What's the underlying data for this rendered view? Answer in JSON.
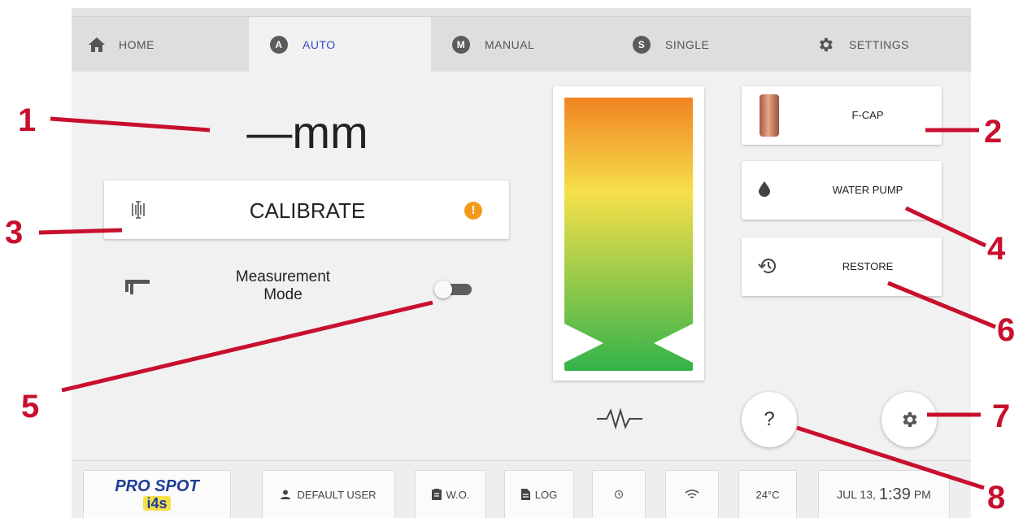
{
  "tabs": {
    "home": "HOME",
    "auto": "AUTO",
    "manual": "MANUAL",
    "single": "SINGLE",
    "settings": "SETTINGS"
  },
  "tab_letters": {
    "auto": "A",
    "manual": "M",
    "single": "S"
  },
  "reading": {
    "value": "—mm"
  },
  "calibrate": {
    "label": "CALIBRATE"
  },
  "measurement": {
    "line1": "Measurement",
    "line2": "Mode",
    "enabled": false
  },
  "buttons": {
    "fcap": "F-CAP",
    "water_pump": "WATER PUMP",
    "restore": "RESTORE",
    "help": "?"
  },
  "gauge": {
    "colors": {
      "top": "#f08a24",
      "mid": "#f5e14a",
      "bottom": "#3cb54a"
    }
  },
  "footer": {
    "brand_line1": "PRO SPOT",
    "brand_line2": "i4s",
    "user": "DEFAULT USER",
    "wo": "W.O.",
    "log": "LOG",
    "temp": "24°C",
    "date": "JUL 13,",
    "time": "1:39",
    "ampm": "PM"
  },
  "callouts": [
    "1",
    "2",
    "3",
    "4",
    "5",
    "6",
    "7",
    "8"
  ],
  "accent_color": "#c8102e"
}
